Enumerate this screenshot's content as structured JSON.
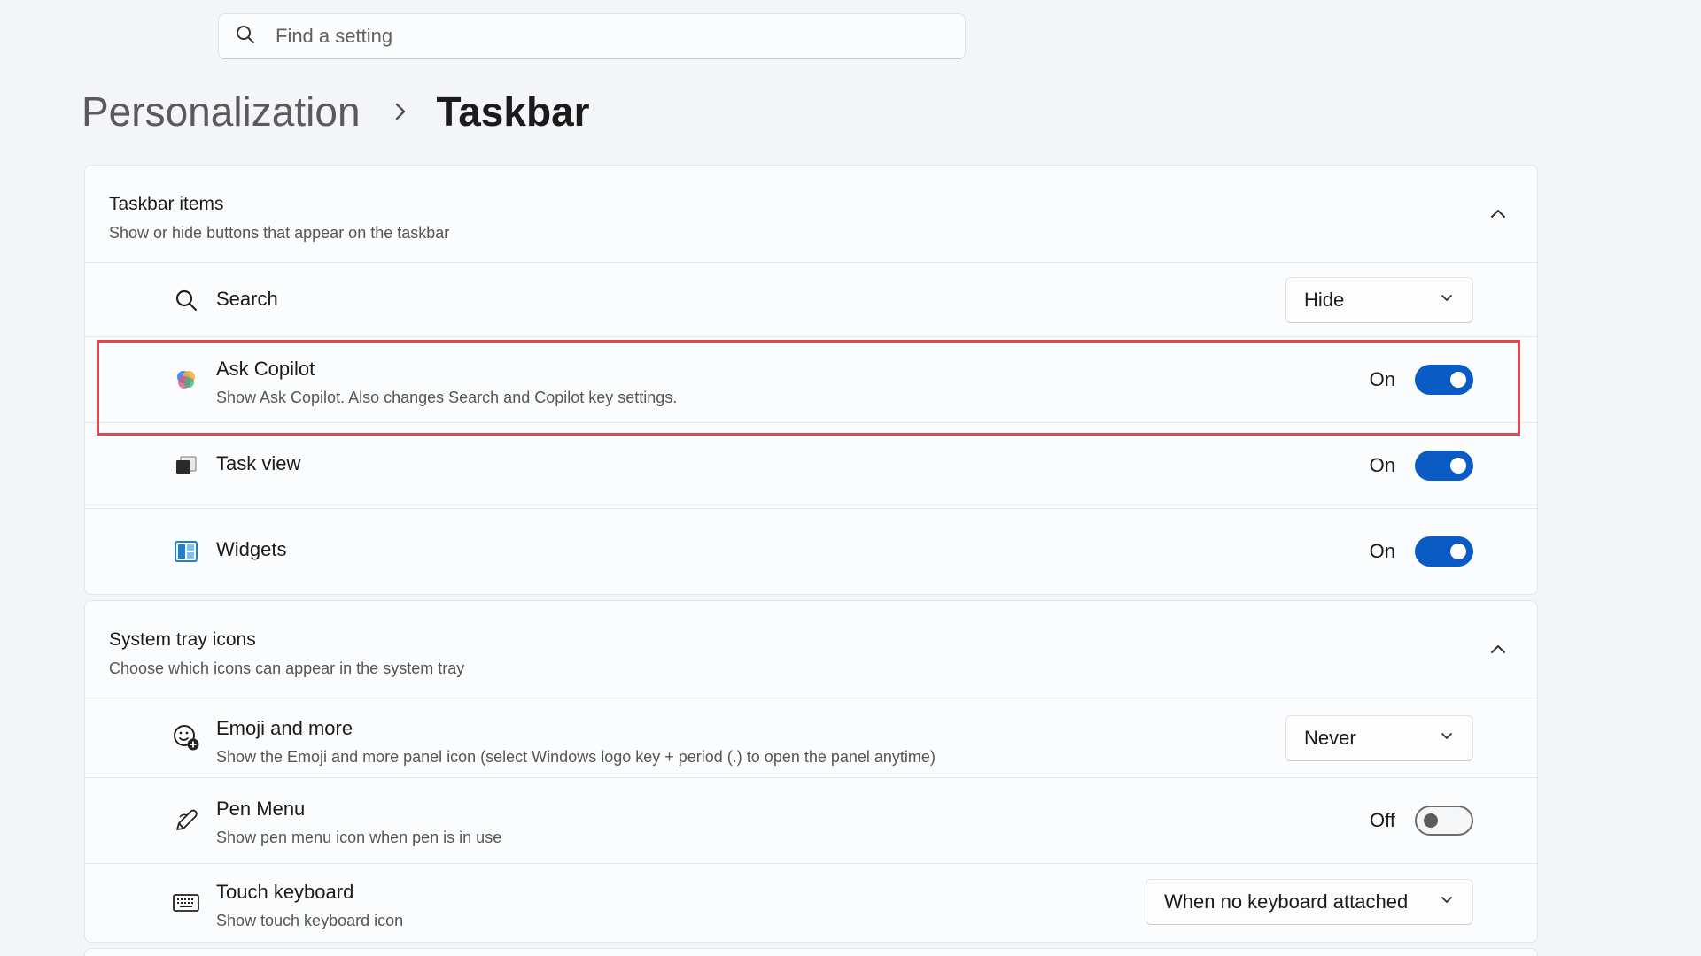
{
  "search": {
    "placeholder": "Find a setting",
    "icon": "search-icon"
  },
  "breadcrumb": {
    "parent": "Personalization",
    "current": "Taskbar"
  },
  "taskbar_items": {
    "title": "Taskbar items",
    "subtitle": "Show or hide buttons that appear on the taskbar",
    "rows": {
      "search": {
        "title": "Search",
        "value": "Hide",
        "icon": "search-icon"
      },
      "copilot": {
        "title": "Ask Copilot",
        "desc": "Show Ask Copilot. Also changes Search and Copilot key settings.",
        "state": "On",
        "icon": "copilot-icon"
      },
      "taskview": {
        "title": "Task view",
        "state": "On",
        "icon": "task-view-icon"
      },
      "widgets": {
        "title": "Widgets",
        "state": "On",
        "icon": "widgets-icon"
      }
    }
  },
  "system_tray": {
    "title": "System tray icons",
    "subtitle": "Choose which icons can appear in the system tray",
    "rows": {
      "emoji": {
        "title": "Emoji and more",
        "desc": "Show the Emoji and more panel icon (select Windows logo key + period (.) to open the panel anytime)",
        "value": "Never",
        "icon": "emoji-icon"
      },
      "pen": {
        "title": "Pen Menu",
        "desc": "Show pen menu icon when pen is in use",
        "state": "Off",
        "icon": "pen-icon"
      },
      "touch": {
        "title": "Touch keyboard",
        "desc": "Show touch keyboard icon",
        "value": "When no keyboard attached",
        "icon": "keyboard-icon"
      }
    }
  },
  "colors": {
    "accent": "#0a5bc4",
    "highlight": "#e0474c"
  }
}
